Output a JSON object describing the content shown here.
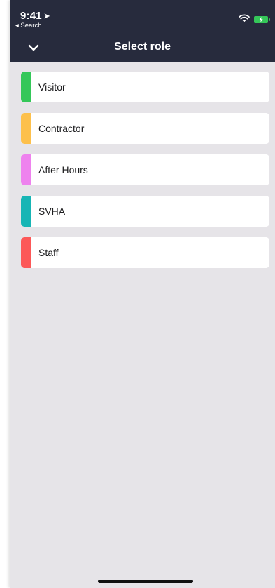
{
  "status_bar": {
    "time": "9:41",
    "back_label": "◂ Search",
    "location_icon": "location-arrow-icon",
    "wifi_icon": "wifi-icon",
    "battery_icon": "battery-charging-icon"
  },
  "header": {
    "title": "Select role",
    "dismiss_icon": "chevron-down-icon"
  },
  "roles": [
    {
      "label": "Visitor",
      "color": "#34c759"
    },
    {
      "label": "Contractor",
      "color": "#fdc04c"
    },
    {
      "label": "After Hours",
      "color": "#ee82ee"
    },
    {
      "label": "SVHA",
      "color": "#17b5b5"
    },
    {
      "label": "Staff",
      "color": "#fc5858"
    }
  ],
  "colors": {
    "header_bg": "#272b3d",
    "screen_bg": "#e6e4e8",
    "battery": "#35c759"
  }
}
